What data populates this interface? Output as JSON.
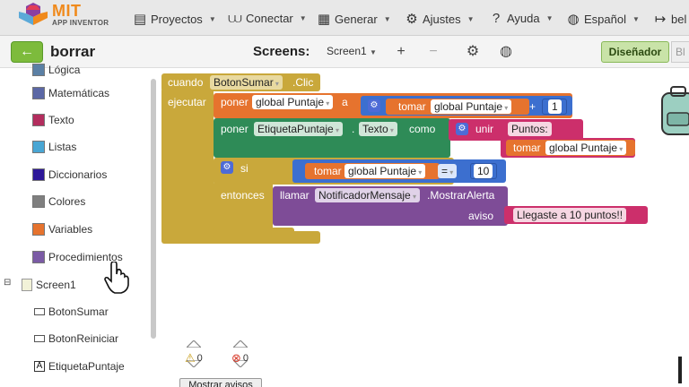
{
  "header": {
    "logo_title": "MIT",
    "logo_subtitle": "APP INVENTOR",
    "menus": [
      {
        "label": "Proyectos",
        "icon": "folder-icon"
      },
      {
        "label": "Conectar",
        "icon": "wifi-icon"
      },
      {
        "label": "Generar",
        "icon": "build-icon"
      },
      {
        "label": "Ajustes",
        "icon": "gear-icon"
      },
      {
        "label": "Ayuda",
        "icon": "help-icon"
      },
      {
        "label": "Español",
        "icon": "globe-icon"
      },
      {
        "label": "bel",
        "icon": "account-icon"
      }
    ]
  },
  "toolbar": {
    "back_label": "←",
    "project_name": "borrar",
    "screens_label": "Screens:",
    "screen_select": "Screen1",
    "add_label": "+",
    "remove_label": "−",
    "designer_label": "Diseñador",
    "blocks_label": "Bl"
  },
  "sidebar": {
    "categories": [
      {
        "label": "Lógica",
        "color": "#5b80a5"
      },
      {
        "label": "Matemáticas",
        "color": "#5b67a5"
      },
      {
        "label": "Texto",
        "color": "#b32d5e"
      },
      {
        "label": "Listas",
        "color": "#49a6d4"
      },
      {
        "label": "Diccionarios",
        "color": "#2d1799"
      },
      {
        "label": "Colores",
        "color": "#7f7f7f"
      },
      {
        "label": "Variables",
        "color": "#e6732e"
      },
      {
        "label": "Procedimientos",
        "color": "#7b5ba5"
      }
    ],
    "screen_node": "Screen1",
    "components": [
      "BotonSumar",
      "BotonReiniciar",
      "EtiquetaPuntaje"
    ]
  },
  "blocks": {
    "event_when": "cuando",
    "event_component": "BotonSumar",
    "event_name": ".Clic",
    "event_do": "ejecutar",
    "set1_word": "poner",
    "set1_var": "global Puntaje",
    "set1_to": "a",
    "get1_word": "tomar",
    "get1_var": "global Puntaje",
    "plus_op": "+",
    "num_one": "1",
    "set2_word": "poner",
    "set2_component": "EtiquetaPuntaje",
    "set2_dot": ".",
    "set2_prop": "Texto",
    "set2_to": "como",
    "join_word": "unir",
    "text_puntos": "Puntos:",
    "get2_word": "tomar",
    "get2_var": "global Puntaje",
    "if_word": "si",
    "get3_word": "tomar",
    "get3_var": "global Puntaje",
    "eq_op": "=",
    "num_ten": "10",
    "then_word": "entonces",
    "call_word": "llamar",
    "call_component": "NotificadorMensaje",
    "call_method": ".MostrarAlerta",
    "call_param": "aviso",
    "alert_text": "Llegaste a 10 puntos!!"
  },
  "warnings": {
    "warning_count": "0",
    "error_count": "0",
    "show_label": "Mostrar avisos"
  },
  "colors": {
    "event": "#c9a83b",
    "variable": "#e6732e",
    "component_set": "#2e8b57",
    "text": "#cc2f6b",
    "math": "#3c6fcf",
    "control": "#c9a83b",
    "procedure_call": "#7e4c97",
    "designer_button": "#c9e3a8"
  }
}
